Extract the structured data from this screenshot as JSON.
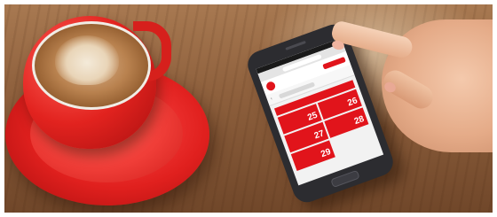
{
  "phone_app": {
    "dates": [
      "25",
      "26",
      "27",
      "28",
      "29"
    ]
  },
  "colors": {
    "accent": "#e1141b",
    "cup": "#e2231f",
    "table": "#8d5f3c"
  }
}
